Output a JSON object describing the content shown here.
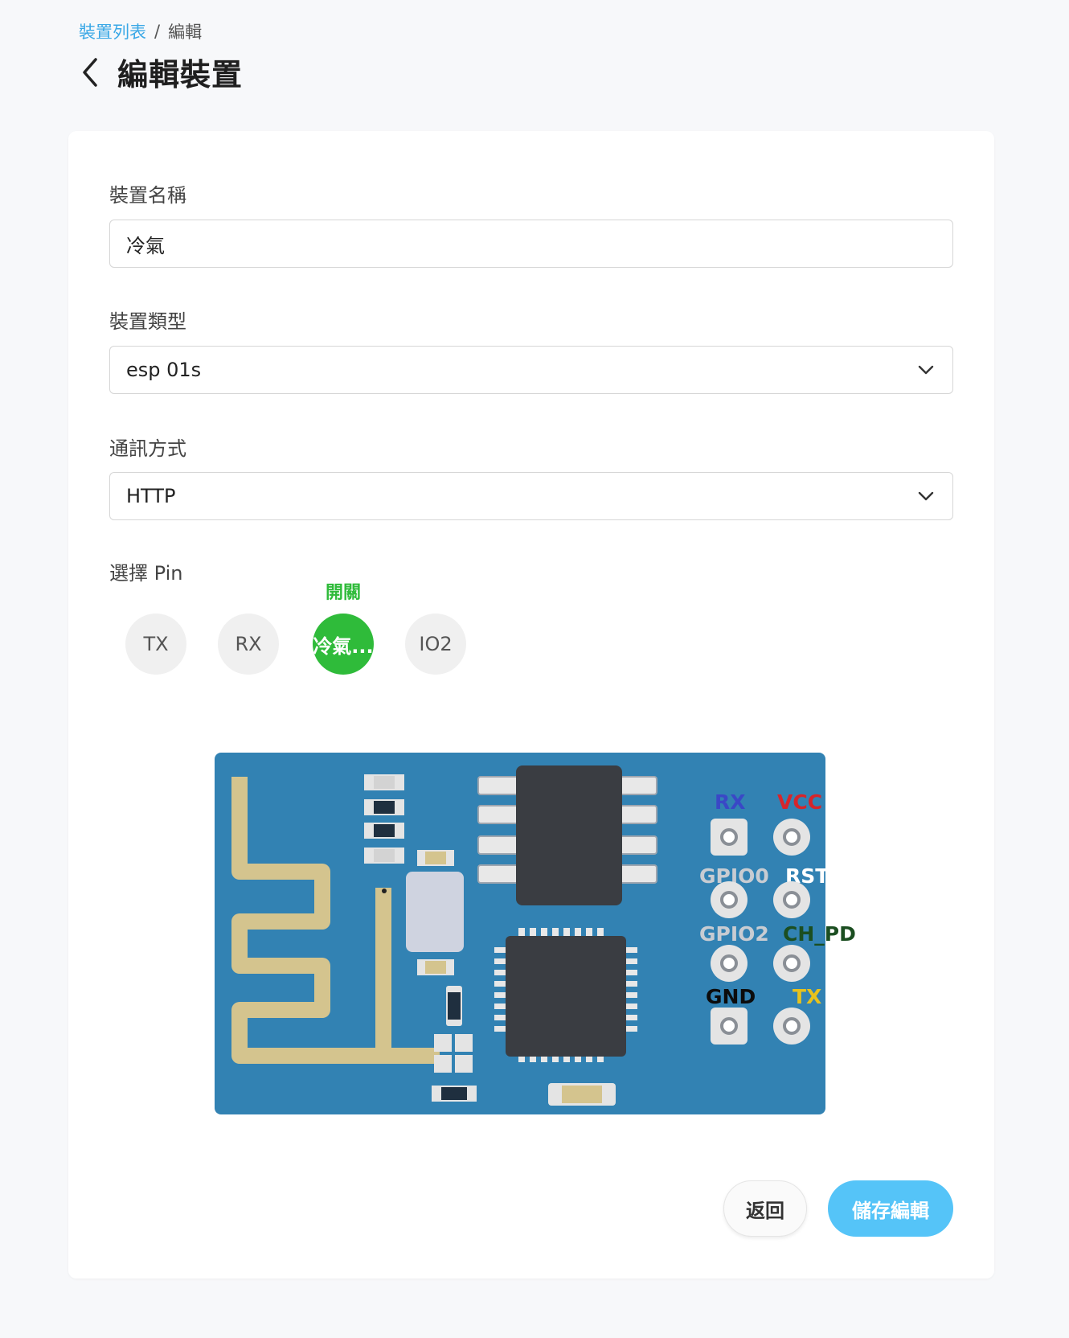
{
  "breadcrumb": {
    "parent": "裝置列表",
    "separator": "/",
    "current": "編輯"
  },
  "header": {
    "title": "編輯裝置"
  },
  "form": {
    "name": {
      "label": "裝置名稱",
      "value": "冷氣"
    },
    "type": {
      "label": "裝置類型",
      "value": "esp 01s"
    },
    "comm": {
      "label": "通訊方式",
      "value": "HTTP"
    },
    "pins": {
      "label": "選擇 Pin",
      "items": [
        {
          "label": "TX",
          "selected": false
        },
        {
          "label": "RX",
          "selected": false
        },
        {
          "label": "冷氣...",
          "selected": true,
          "tag": "開關"
        },
        {
          "label": "IO2",
          "selected": false
        }
      ]
    }
  },
  "board": {
    "pin_labels": {
      "rx": "RX",
      "vcc": "VCC",
      "gpio0": "GPIO0",
      "rst": "RST",
      "gpio2": "GPIO2",
      "ch_pd": "CH_PD",
      "gnd": "GND",
      "tx": "TX"
    }
  },
  "actions": {
    "back": "返回",
    "save": "儲存編輯"
  },
  "colors": {
    "accent": "#55c4f8",
    "link": "#3aa8e6",
    "pin_active": "#2fbb3a",
    "board": "#3282b3"
  }
}
